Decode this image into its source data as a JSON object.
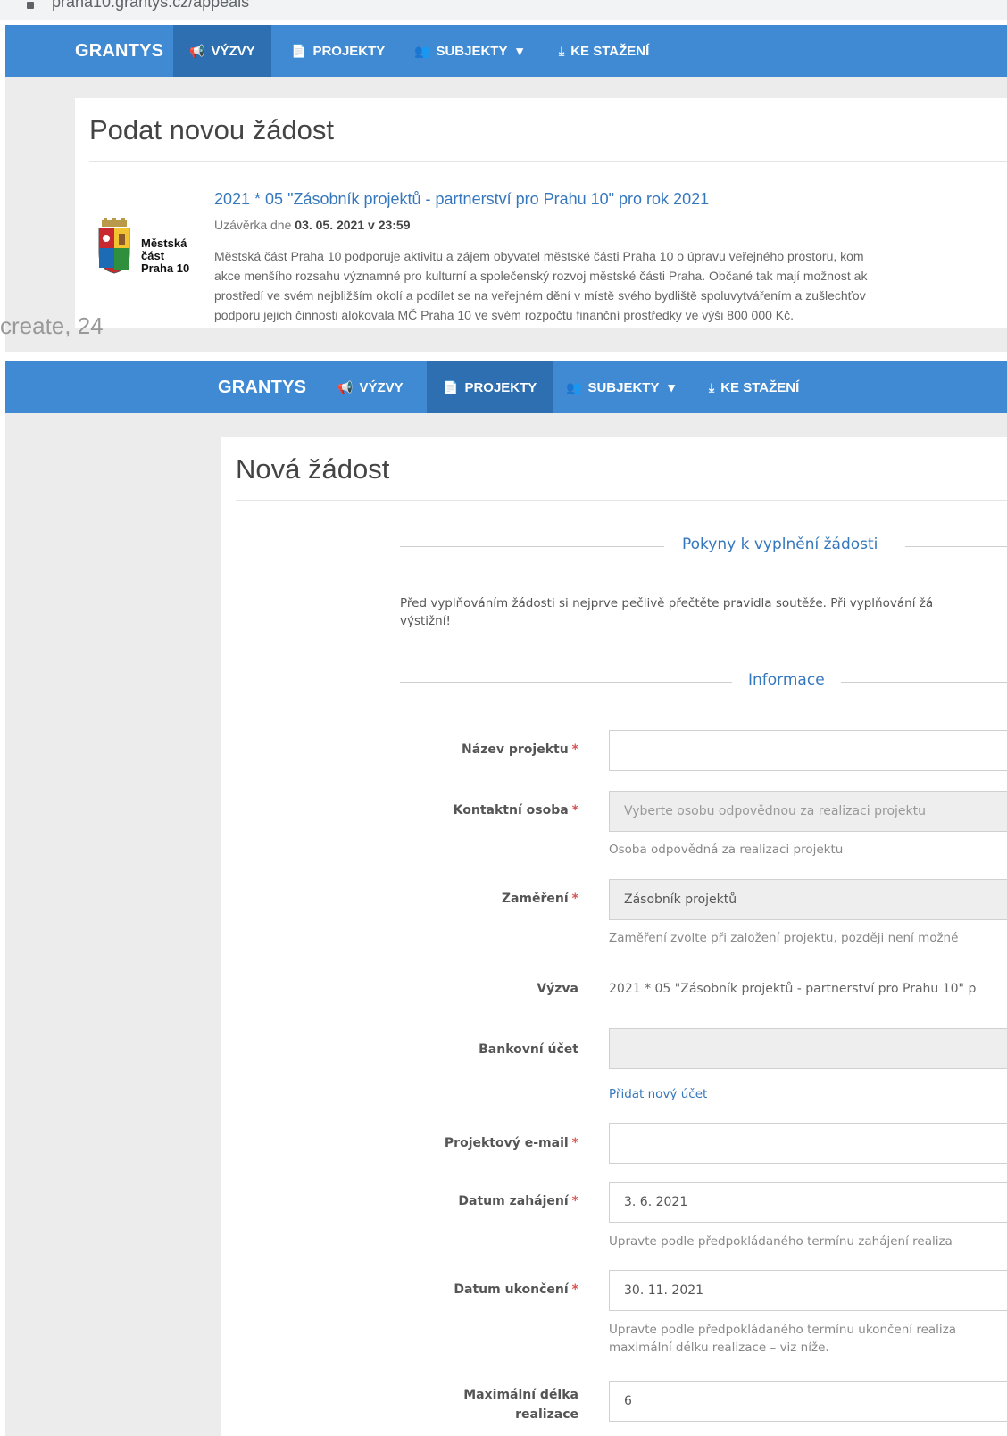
{
  "browser": {
    "url": "praha10.grantys.cz/appeals"
  },
  "nav": {
    "brand": "GRANTYS",
    "items": [
      {
        "label": "VÝZVY",
        "icon": "bullhorn-icon"
      },
      {
        "label": "PROJEKTY",
        "icon": "file-icon"
      },
      {
        "label": "SUBJEKTY",
        "icon": "users-icon",
        "caret": "▾"
      },
      {
        "label": "KE STAŽENÍ",
        "icon": "download-icon"
      }
    ]
  },
  "appeal_page": {
    "title": "Podat novou žádost",
    "logo": {
      "line1": "Městská",
      "line2": "část",
      "line3": "Praha 10"
    },
    "call": {
      "title": "2021 * 05 \"Zásobník projektů - partnerství pro Prahu 10\" pro rok 2021",
      "deadline_prefix": "Uzávěrka dne",
      "deadline_value": "03. 05. 2021 v 23:59",
      "description": [
        "Městská část Praha 10 podporuje aktivitu a zájem obyvatel městské části Praha 10 o úpravu veřejného prostoru, kom",
        "akce menšího rozsahu významné pro kulturní a společenský rozvoj městské části Praha. Občané tak mají možnost ak",
        "prostředí ve svém nejbližším okolí a podílet se na veřejném dění v místě svého bydliště spoluvytvářením a zušlechťov",
        "podporu jejich činnosti alokovala MČ Praha 10 ve svém rozpočtu finanční prostředky ve výši 800 000 Kč."
      ]
    },
    "overlap_text": "create, 24"
  },
  "new_request": {
    "title": "Nová žádost",
    "section_instructions": "Pokyny k vyplnění žádosti",
    "instructions": [
      "Před vyplňováním žádosti si nejprve pečlivě přečtěte pravidla soutěže. Při vyplňování žá",
      "výstižní!"
    ],
    "section_info": "Informace",
    "required_mark": "*",
    "fields": {
      "project_name": {
        "label": "Název projektu",
        "value": ""
      },
      "contact_person": {
        "label": "Kontaktní osoba",
        "placeholder": "Vyberte osobu odpovědnou za realizaci projektu",
        "help": "Osoba odpovědná za realizaci projektu"
      },
      "focus": {
        "label": "Zaměření",
        "value": "Zásobník projektů",
        "help": "Zaměření zvolte při založení projektu, později není možné"
      },
      "call": {
        "label": "Výzva",
        "value": "2021 * 05 \"Zásobník projektů - partnerství pro Prahu 10\" p"
      },
      "bank_account": {
        "label": "Bankovní účet",
        "value": "",
        "link": "Přidat nový účet"
      },
      "project_email": {
        "label": "Projektový e-mail",
        "value": ""
      },
      "start_date": {
        "label": "Datum zahájení",
        "value": "3. 6. 2021",
        "help": "Upravte podle předpokládaného termínu zahájení realiza"
      },
      "end_date": {
        "label": "Datum ukončení",
        "value": "30. 11. 2021",
        "help_line1": "Upravte podle předpokládaného termínu ukončení realiza",
        "help_line2": "maximální délku realizace – viz níže."
      },
      "max_length": {
        "label_line1": "Maximální délka",
        "label_line2": "realizace",
        "value": "6"
      }
    }
  }
}
